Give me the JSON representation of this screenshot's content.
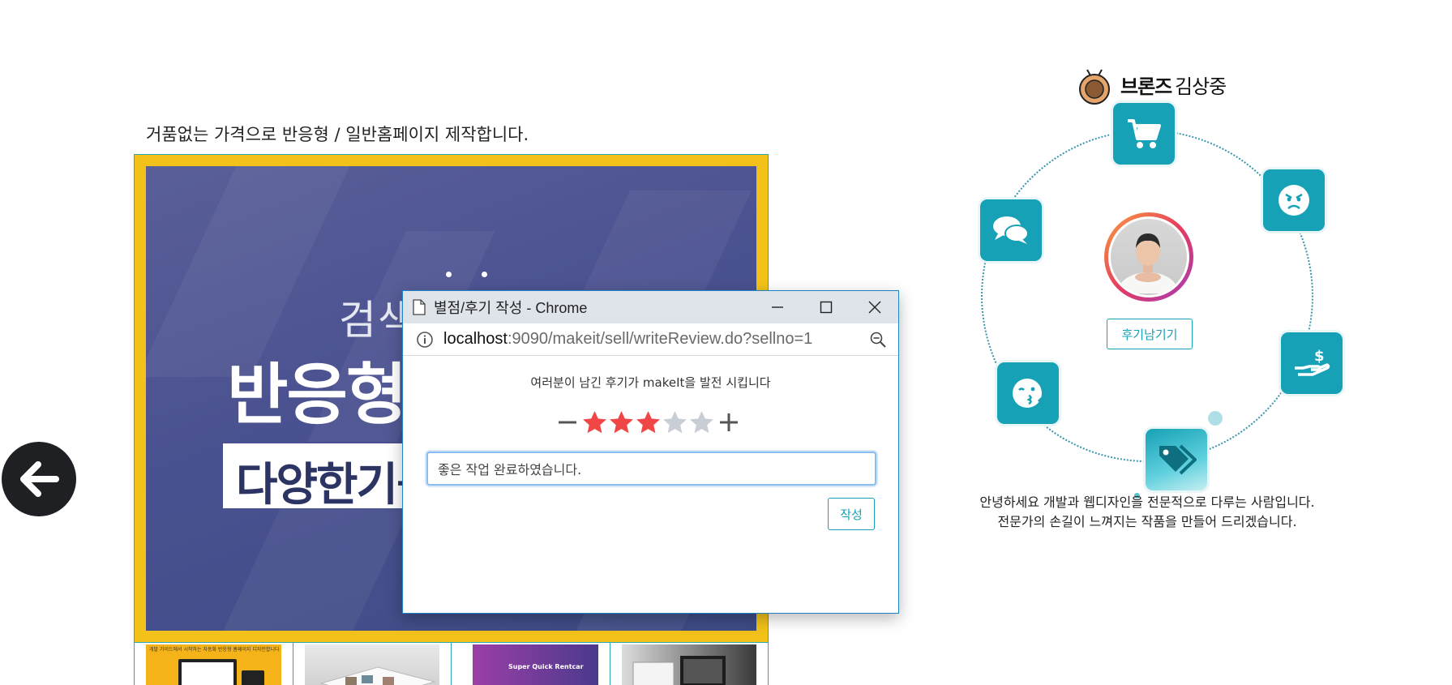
{
  "product": {
    "title": "거품없는 가격으로 반응형 / 일반홈페이지 제작합니다.",
    "banner": {
      "small_text": "검색",
      "big_text": "반응형",
      "box_text": "다양한기능"
    },
    "thumbnails": [
      {
        "caption": "개발 가이드에서 시작하는 자동화 반응형 홈페이지 디자인합니다",
        "overlay": ""
      },
      {
        "caption": "",
        "overlay": ""
      },
      {
        "caption": "",
        "overlay": "Super Quick Rentcar"
      },
      {
        "caption": "",
        "overlay": ""
      }
    ]
  },
  "nav": {
    "back_icon": "arrow-left-icon"
  },
  "seller": {
    "grade": "브론즈",
    "name": "김상중",
    "medal_icon": "bronze-medal-icon",
    "review_button": "후기남기기",
    "intro_line1": "안녕하세요 개발과 웹디자인을 전문적으로 다루는 사람입니다.",
    "intro_line2": "전문가의 손길이 느껴지는 작품을 만들어 드리겠습니다.",
    "icons": [
      "cart-icon",
      "angry-face-icon",
      "money-hand-icon",
      "price-tag-icon",
      "kiss-face-icon",
      "chat-bubbles-icon"
    ],
    "accent": "#17a1b6"
  },
  "popup": {
    "window_title": "별점/후기 작성 - Chrome",
    "url_host": "localhost",
    "url_path": ":9090/makeit/sell/writeReview.do?sellno=1",
    "prompt": "여러분이 남긴 후기가 makeIt을 발전 시킵니다",
    "rating": 3,
    "rating_max": 5,
    "review_text": "좋은 작업 완료하였습니다.",
    "submit_label": "작성",
    "star_active_color": "#f04646",
    "star_inactive_color": "#c9ced6"
  }
}
